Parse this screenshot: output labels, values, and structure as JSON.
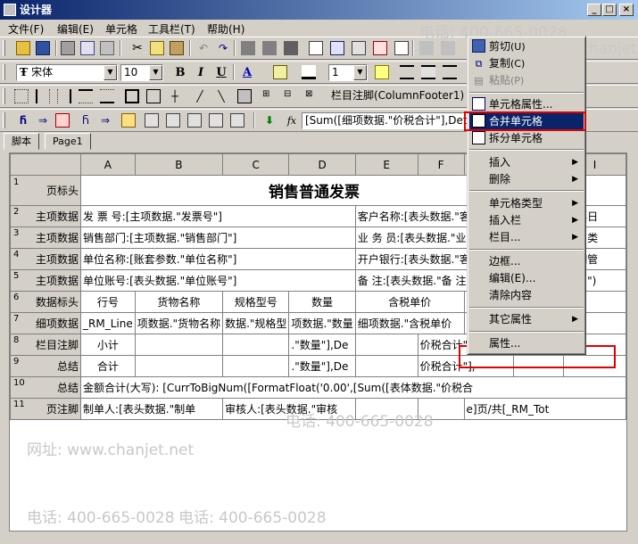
{
  "window": {
    "title": "设计器",
    "btn_min": "_",
    "btn_max": "□",
    "btn_close": "×"
  },
  "menu": [
    "文件(F)",
    "编辑(E)",
    "单元格",
    "工具栏(T)",
    "帮助(H)"
  ],
  "font": {
    "name": "宋体",
    "size": "10",
    "line_width": "1",
    "bold": "B",
    "italic": "I",
    "underline": "U",
    "color_letter": "A"
  },
  "cell_name": "栏目注脚(ColumnFooter1)",
  "formula": "[Sum([细项数据.\"价税合计\"],Det",
  "fx": "fx",
  "tabs": [
    "脚本",
    "Page1"
  ],
  "columns": [
    "A",
    "B",
    "C",
    "D",
    "E",
    "F",
    "",
    "",
    "I"
  ],
  "rows": [
    {
      "num": "1",
      "band": "页标头"
    },
    {
      "num": "2",
      "band": "主项数据",
      "cells": [
        "发 票 号:[主项数据.\"发票号\"]",
        "客户名称:[表头数据.\"客户名称",
        "开票日"
      ]
    },
    {
      "num": "3",
      "band": "主项数据",
      "cells": [
        "销售部门:[主项数据.\"销售部门\"]",
        "业 务 员:[表头数据.\"业 务 员",
        "销售类"
      ]
    },
    {
      "num": "4",
      "band": "主项数据",
      "cells": [
        "单位名称:[账套参数.\"单位名称\"]",
        "开户银行:[表头数据.\"客户开户",
        "账期管"
      ]
    },
    {
      "num": "5",
      "band": "主项数据",
      "cells": [
        "单位账号:[表头数据.\"单位账号\"]",
        "备    注:[表头数据.\"备     注\"]",
        "期日\")"
      ]
    },
    {
      "num": "6",
      "band": "数据标头",
      "cells": [
        "行号",
        "货物名称",
        "规格型号",
        "数量",
        "含税单价"
      ]
    },
    {
      "num": "7",
      "band": "细项数据",
      "cells": [
        "_RM_Line",
        "项数据.\"货物名称",
        "数据.\"规格型",
        "项数据.\"数量",
        "细项数据.\"含税单价",
        "\"]"
      ]
    },
    {
      "num": "8",
      "band": "栏目注脚",
      "cells": [
        "小计",
        ".\"数量\"],De",
        "价税合计\"],"
      ]
    },
    {
      "num": "9",
      "band": "总结",
      "cells": [
        "合计",
        ".\"数量\"],De",
        "价税合计\"],"
      ]
    },
    {
      "num": "10",
      "band": "总结",
      "cells": [
        "金额合计(大写): [CurrToBigNum([FormatFloat('0.00',[Sum([表体数据.\"价税合"
      ]
    },
    {
      "num": "11",
      "band": "页注脚",
      "cells": [
        "制单人:[表头数据.\"制单",
        "审核人:[表头数据.\"审核",
        "e]页/共[_RM_Tot"
      ]
    }
  ],
  "report_title": "销售普通发票",
  "context_menu": {
    "cut": "剪切",
    "cut_key": "(U)",
    "copy": "复制",
    "copy_key": "(C)",
    "paste": "粘贴",
    "paste_key": "(P)",
    "cell_props": "单元格属性...",
    "merge": "合并单元格",
    "split": "拆分单元格",
    "insert": "插入",
    "delete": "删除",
    "cell_type": "单元格类型",
    "insert_band": "插入栏",
    "band": "栏目...",
    "border": "边框...",
    "edit": "编辑(E)...",
    "clear": "清除内容",
    "other_props": "其它属性",
    "props": "属性..."
  },
  "watermark": {
    "phone": "电话: 400-665-0028",
    "site": "网址: www.chanjet.net"
  },
  "colors": {
    "highlight": "#0a246a",
    "redbox": "#e00000"
  }
}
